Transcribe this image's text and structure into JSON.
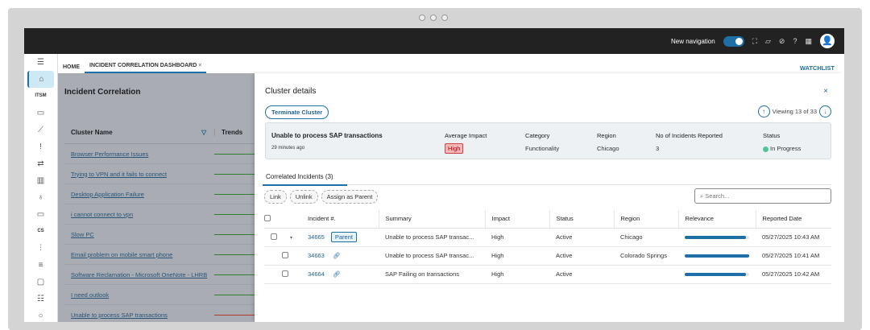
{
  "topbar": {
    "new_nav_label": "New navigation",
    "new_nav_on": true
  },
  "tabs": {
    "home": "HOME",
    "dashboard": "INCIDENT CORRELATION DASHBOARD",
    "close": "×",
    "watchlist": "WATCHLIST"
  },
  "sidebar": {
    "itsm": "ITSM",
    "cs": "CS"
  },
  "left": {
    "title": "Incident Correlation",
    "col_cluster": "Cluster Name",
    "col_trends": "Trends",
    "clusters": [
      "Browser Performance Issues",
      "Trying to VPN and it fails to connect",
      "Desktop Application Failure",
      "i cannot connect to vpn",
      "Slow PC",
      "Email problem on mobile smart phone",
      "Software Reclamation - Microsoft OneNote - LHRB",
      "I need outlook",
      "Unable to process SAP transactions"
    ]
  },
  "panel": {
    "title": "Cluster details",
    "close": "×",
    "terminate": "Terminate Cluster",
    "viewing": "Viewing 13 of 33",
    "cluster": {
      "name": "Unable to process SAP transactions",
      "time": "29 minutes ago",
      "impact_label": "Average Impact",
      "impact": "High",
      "category_label": "Category",
      "category": "Functionality",
      "region_label": "Region",
      "region": "Chicago",
      "count_label": "No of Incidents Reported",
      "count": "3",
      "status_label": "Status",
      "status": "In Progress"
    },
    "tab": "Correlated Incidents (3)",
    "link": "Link",
    "unlink": "Unlink",
    "assign": "Assign as Parent",
    "search_placeholder": "Search...",
    "columns": [
      "Incident #.",
      "Summary",
      "Impact",
      "Status",
      "Region",
      "Relevance",
      "Reported Date"
    ],
    "parent_label": "Parent",
    "rows": [
      {
        "id": "34665",
        "summary": "Unable to process SAP transac...",
        "impact": "High",
        "status": "Active",
        "region": "Chicago",
        "relevance": 0.95,
        "date": "05/27/2025 10:43 AM"
      },
      {
        "id": "34663",
        "summary": "Unable to process SAP transac...",
        "impact": "High",
        "status": "Active",
        "region": "Colorado Springs",
        "relevance": 1.0,
        "date": "05/27/2025 10:41 AM"
      },
      {
        "id": "34664",
        "summary": "SAP Failing on transactions",
        "impact": "High",
        "status": "Active",
        "region": "",
        "relevance": 0.95,
        "date": "05/27/2025 10:42 AM"
      }
    ]
  }
}
